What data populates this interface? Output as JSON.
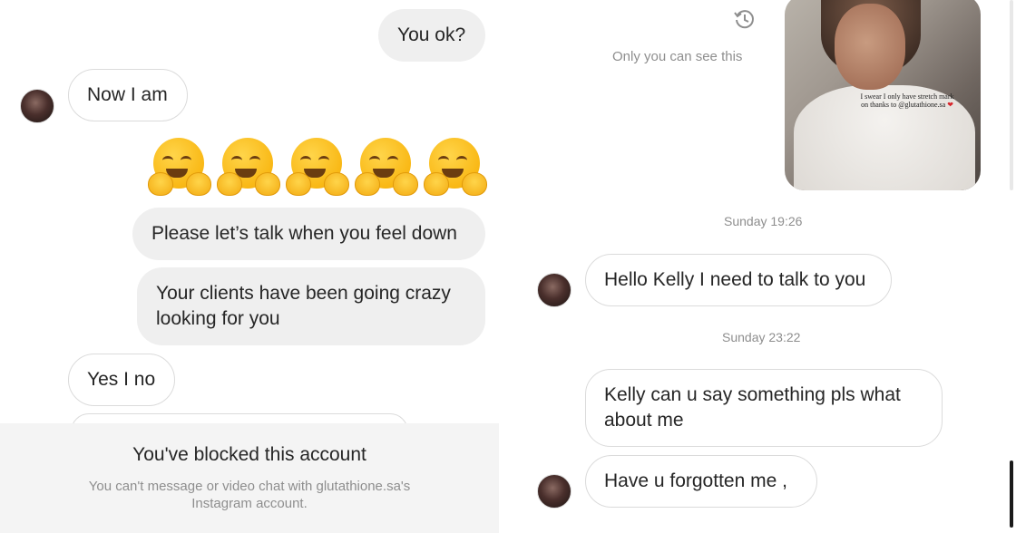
{
  "left": {
    "messages": {
      "you_ok": "You ok?",
      "now_i_am": "Now I am",
      "lets_talk": "Please let’s talk when you feel down",
      "clients": "Your clients have been going crazy looking for you",
      "yes_i_no": "Yes I no"
    },
    "emoji_count": 5,
    "emoji_name": "hugging-face",
    "blocked": {
      "title": "You've blocked this account",
      "subtitle": "You can't message or video chat with glutathione.sa's Instagram account."
    }
  },
  "right": {
    "only_you": "Only you can see this",
    "photo_caption": "I swear I only have stretch mark on thanks to @glutathione.sa",
    "timestamps": [
      "Sunday 19:26",
      "Sunday 23:22"
    ],
    "messages": {
      "hello_kelly": "Hello Kelly I need to talk to you",
      "say_something": "Kelly can u say something  pls  what about me",
      "forgotten": "Have u forgotten  me ,"
    }
  },
  "colors": {
    "sent_bubble": "#efefef",
    "received_border": "#dbdbdb",
    "meta_text": "#8e8e8e",
    "blocked_bg": "#f4f4f4"
  }
}
